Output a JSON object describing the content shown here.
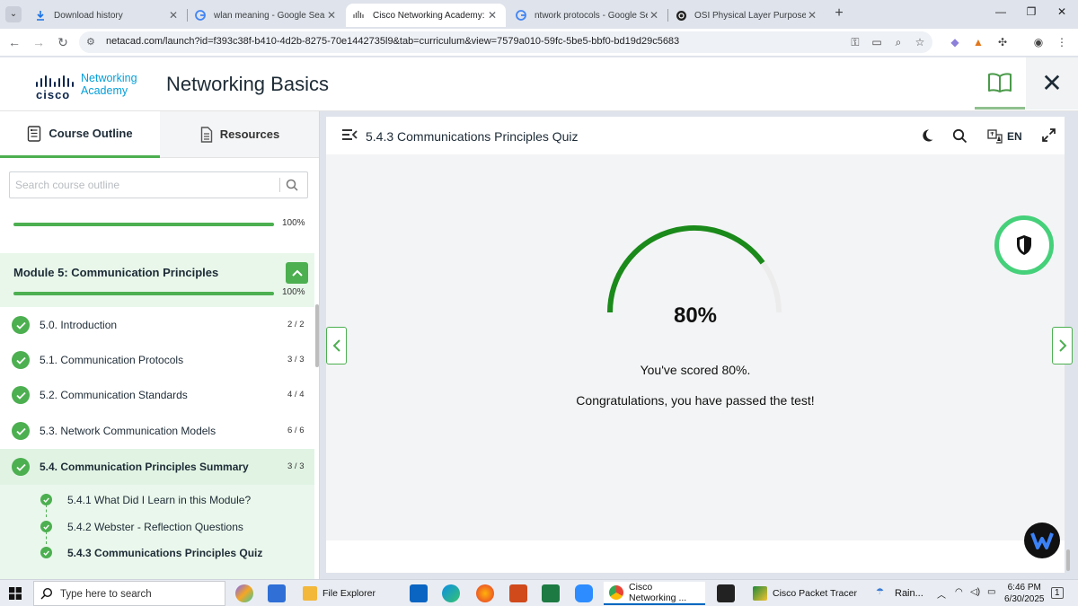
{
  "browser": {
    "tabs": [
      {
        "title": "Download history",
        "icon": "download-icon",
        "active": false
      },
      {
        "title": "wlan meaning - Google Search",
        "icon": "google-icon",
        "active": false
      },
      {
        "title": "Cisco Networking Academy: Co",
        "icon": "cisco-icon",
        "active": true
      },
      {
        "title": "ntwork protocols - Google Sear",
        "icon": "google-icon",
        "active": false
      },
      {
        "title": "OSI Physical Layer Purpose",
        "icon": "openai-icon",
        "active": false
      }
    ],
    "close_glyph": "✕",
    "new_tab_glyph": "+",
    "url": "netacad.com/launch?id=f393c38f-b410-4d2b-8275-70e1442735l9&tab=curriculum&view=7579a010-59fc-5be5-bbf0-bd19d29c5683"
  },
  "site": {
    "logo_brand": "cisco",
    "logo_line1": "Networking",
    "logo_line2": "Academy",
    "course_title": "Networking Basics",
    "close_glyph": "✕"
  },
  "sidebar": {
    "tab_outline": "Course Outline",
    "tab_resources": "Resources",
    "search_placeholder": "Search course outline",
    "prev_module_progress_label": "100%",
    "prev_module_progress": 1.0,
    "module_title": "Module 5: Communication Principles",
    "module_progress_label": "100%",
    "module_progress": 1.0,
    "topics": [
      {
        "label": "5.0. Introduction",
        "count": "2 / 2",
        "active": false
      },
      {
        "label": "5.1. Communication Protocols",
        "count": "3 / 3",
        "active": false
      },
      {
        "label": "5.2. Communication Standards",
        "count": "4 / 4",
        "active": false
      },
      {
        "label": "5.3. Network Communication Models",
        "count": "6 / 6",
        "active": false
      },
      {
        "label": "5.4. Communication Principles Summary",
        "count": "3 / 3",
        "active": true
      }
    ],
    "subitems": [
      {
        "label": "5.4.1 What Did I Learn in this Module?",
        "current": false
      },
      {
        "label": "5.4.2 Webster - Reflection Questions",
        "current": false
      },
      {
        "label": "5.4.3 Communications Principles Quiz",
        "current": true
      }
    ]
  },
  "content": {
    "title": "5.4.3 Communications Principles Quiz",
    "language": "EN",
    "score_value": 0.8,
    "score_big": "80%",
    "score_text": "You've scored 80%.",
    "congrats_text": "Congratulations, you have passed the test!"
  },
  "taskbar": {
    "search_placeholder": "Type here to search",
    "apps": [
      {
        "label": "File Explorer",
        "active": false
      },
      {
        "label": "Cisco Networking ...",
        "active": true
      },
      {
        "label": "Cisco Packet Tracer",
        "active": false
      }
    ],
    "weather": "Rain...",
    "time": "6:46 PM",
    "date": "6/30/2025",
    "notification_count": "1"
  },
  "colors": {
    "accent_green": "#4caf50",
    "gauge_green": "#1a8a1a",
    "brand_blue": "#049fd9"
  }
}
